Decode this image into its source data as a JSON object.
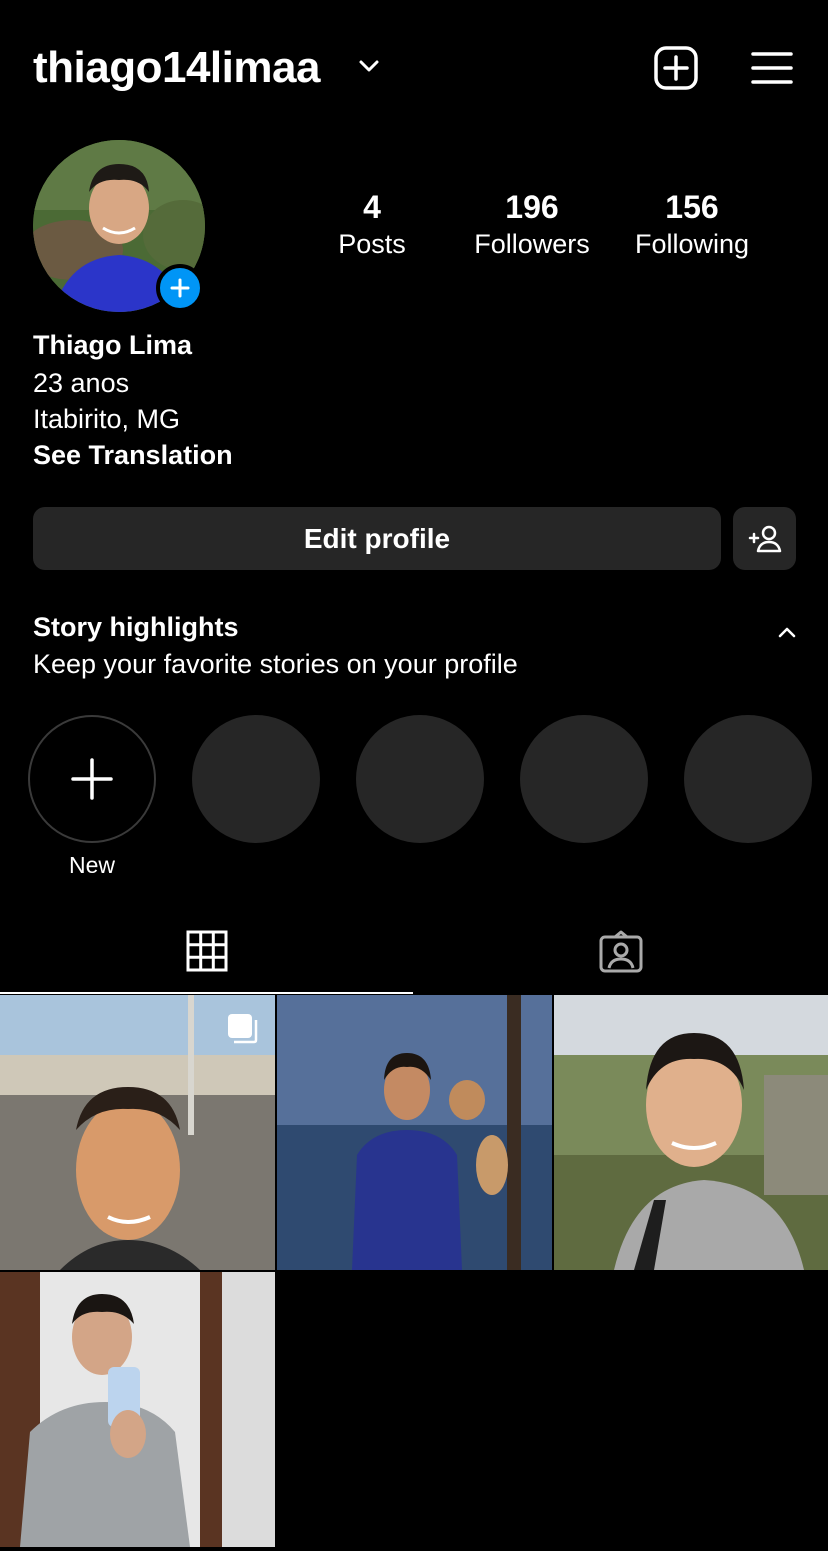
{
  "header": {
    "username": "thiago14limaa"
  },
  "stats": {
    "posts": {
      "count": "4",
      "label": "Posts"
    },
    "followers": {
      "count": "196",
      "label": "Followers"
    },
    "following": {
      "count": "156",
      "label": "Following"
    }
  },
  "bio": {
    "name": "Thiago Lima",
    "line1": "23 anos",
    "line2": "Itabirito, MG",
    "translate": "See Translation"
  },
  "actions": {
    "edit_profile": "Edit profile"
  },
  "highlights": {
    "title": "Story highlights",
    "subtitle": "Keep your favorite stories on your profile",
    "new_label": "New"
  },
  "colors": {
    "background": "#000000",
    "button_bg": "#262626",
    "accent_blue": "#0095f6",
    "text": "#ffffff"
  },
  "icons": [
    "chevron-down-icon",
    "new-post-icon",
    "menu-icon",
    "add-story-icon",
    "add-person-icon",
    "chevron-up-icon",
    "plus-icon",
    "grid-icon",
    "tagged-icon",
    "carousel-icon"
  ]
}
